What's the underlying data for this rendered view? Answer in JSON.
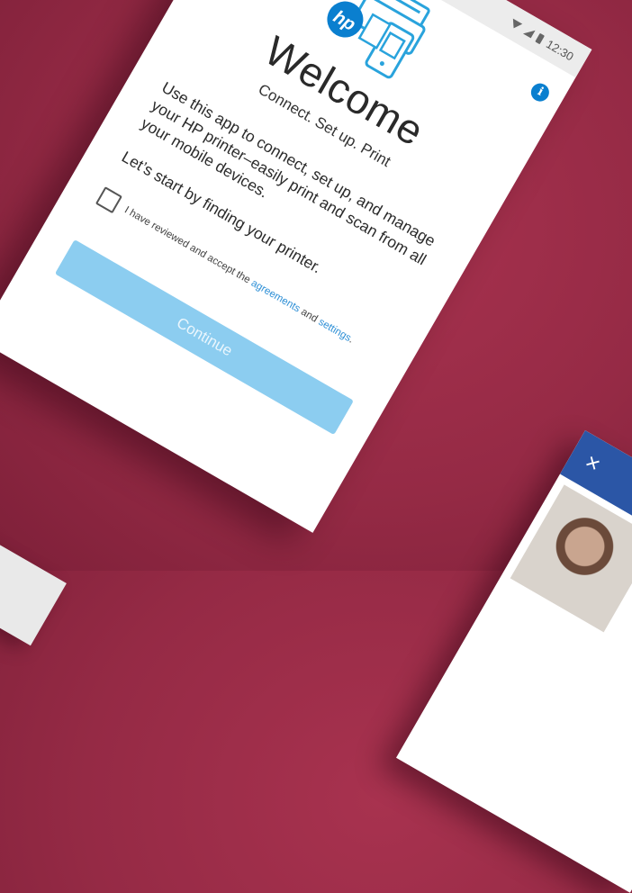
{
  "status_bar": {
    "time": "12:30"
  },
  "welcome": {
    "title": "Welcome",
    "subtitle": "Connect. Set up. Print",
    "body": "Use this app to connect, set up, and manage your HP printer–easily print and scan from all your mobile devices.",
    "lets_start": "Let’s start by finding your printer.",
    "agreement_prefix": "I have reviewed and accept the",
    "agreement_link": "agreements",
    "agreement_and": "and",
    "settings_link": "settings",
    "agreement_suffix": ".",
    "continue_label": "Continue",
    "checkbox_checked": false
  },
  "icons": {
    "info": "info-icon",
    "logo": "hp-logo-icon",
    "close": "close-icon"
  },
  "second_device": {
    "close_glyph": "×"
  },
  "colors": {
    "background": "#952a45",
    "accent": "#0a7fcf",
    "continue_button": "#8ccdf0",
    "second_device_bar": "#2b56a6"
  }
}
